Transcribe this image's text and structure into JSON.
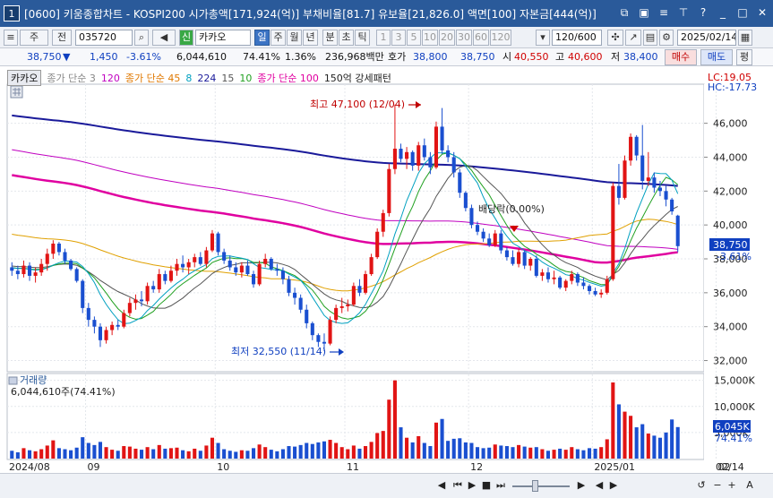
{
  "window": {
    "number": "1",
    "title": "[0600] 키움종합차트 - KOSPI200 시가총액[171,924(억)] 부채비율[81.7] 유보율[21,826.0] 액면[100] 자본금[444(억)]"
  },
  "toolbar": {
    "period_main": "주",
    "period_prev": "전",
    "stock_code": "035720",
    "signal": "신",
    "stock_name": "카카오",
    "periods": [
      "일",
      "주",
      "월",
      "년",
      "분",
      "초",
      "틱"
    ],
    "selected_period": "일",
    "intervals": [
      "1",
      "3",
      "5",
      "10",
      "20",
      "30",
      "60",
      "120"
    ],
    "count": "120/600",
    "date": "2025/02/14"
  },
  "infobar": {
    "price": "38,750",
    "arrow": "▼",
    "change": "1,450",
    "rate": "-3.61%",
    "volume": "6,044,610",
    "vol_rate": "74.41%",
    "turnover": "1.36%",
    "amount": "236,968백만",
    "bid_label": "호가",
    "bid": "38,800",
    "ask": "38,750",
    "open_label": "시",
    "open": "40,550",
    "high_label": "고",
    "high": "40,600",
    "low_label": "저",
    "low": "38,400",
    "buy": "매수",
    "sell": "매도",
    "eval": "평"
  },
  "legend": {
    "stock": "카카오",
    "items": [
      {
        "text": "종가 단순 3",
        "color": "#888888"
      },
      {
        "text": "120",
        "color": "#c000c0"
      },
      {
        "text": "종가 단순 45",
        "color": "#e07800"
      },
      {
        "text": "8",
        "color": "#00a0c0"
      },
      {
        "text": "224",
        "color": "#1a1a9a"
      },
      {
        "text": "15",
        "color": "#555555"
      },
      {
        "text": "10",
        "color": "#20a020"
      },
      {
        "text": "종가 단순 100",
        "color": "#e000a0"
      },
      {
        "text": "150억 강세패턴",
        "color": "#222222"
      }
    ]
  },
  "annotations": {
    "high": "최고 47,100 (12/04)",
    "low": "최저 32,550 (11/14)",
    "event": "배당락(0.00%)",
    "lc": "LC:19.05",
    "hc": "HC:-17.73",
    "cur_price": "38,750",
    "cur_rate": "-3.61%"
  },
  "volume_panel": {
    "title": "거래량",
    "value": "6,044,610주(74.41%)",
    "cur": "6,045K",
    "rate": "74.41%"
  },
  "chart_data": {
    "type": "candlestick",
    "price_axis": {
      "ticks": [
        32000,
        34000,
        36000,
        38000,
        40000,
        42000,
        44000,
        46000
      ],
      "range": [
        31500,
        48200
      ]
    },
    "volume_axis": {
      "ticks": [
        "5,000K",
        "10,000K",
        "15,000K"
      ],
      "max": 15800
    },
    "x_labels": [
      "2024/08",
      "09",
      "10",
      "11",
      "12",
      "2025/01",
      "02",
      "02/14"
    ],
    "ohlcv": [
      [
        37500,
        37800,
        37000,
        37300,
        1500
      ],
      [
        37300,
        37600,
        36800,
        37100,
        1200
      ],
      [
        37100,
        37900,
        36900,
        37600,
        2000
      ],
      [
        37600,
        37800,
        36700,
        37000,
        1600
      ],
      [
        37000,
        37500,
        36600,
        37200,
        1400
      ],
      [
        37200,
        38000,
        37000,
        37700,
        1800
      ],
      [
        37700,
        38600,
        37300,
        38300,
        2500
      ],
      [
        38300,
        39100,
        38000,
        38900,
        3500
      ],
      [
        38900,
        39000,
        38200,
        38400,
        2000
      ],
      [
        38400,
        38600,
        37700,
        37900,
        1800
      ],
      [
        37900,
        38000,
        37300,
        37400,
        1600
      ],
      [
        37400,
        37500,
        36600,
        36700,
        2100
      ],
      [
        36700,
        36800,
        34800,
        35100,
        4100
      ],
      [
        35100,
        35400,
        34000,
        34400,
        3000
      ],
      [
        34400,
        34600,
        33600,
        34000,
        2600
      ],
      [
        34000,
        34200,
        32800,
        33200,
        3200
      ],
      [
        33200,
        34000,
        33000,
        33800,
        2200
      ],
      [
        33800,
        34300,
        33500,
        34100,
        1700
      ],
      [
        34100,
        34400,
        33800,
        34000,
        1500
      ],
      [
        34000,
        35000,
        33900,
        34800,
        2400
      ],
      [
        34800,
        35700,
        34600,
        35400,
        2300
      ],
      [
        35400,
        35900,
        35000,
        35600,
        1900
      ],
      [
        35600,
        36100,
        35200,
        35500,
        1700
      ],
      [
        35500,
        36600,
        35300,
        36400,
        2200
      ],
      [
        36400,
        36700,
        36000,
        36200,
        1800
      ],
      [
        36200,
        37400,
        36000,
        37100,
        2600
      ],
      [
        37100,
        37300,
        36500,
        36700,
        1900
      ],
      [
        36700,
        37600,
        36600,
        37300,
        2000
      ],
      [
        37300,
        38000,
        37000,
        37700,
        2100
      ],
      [
        37700,
        38200,
        37200,
        37500,
        1600
      ],
      [
        37500,
        38000,
        37100,
        37800,
        1400
      ],
      [
        37800,
        38300,
        37500,
        38100,
        1900
      ],
      [
        38100,
        38400,
        37600,
        37700,
        1500
      ],
      [
        37700,
        38700,
        37500,
        38500,
        2500
      ],
      [
        38500,
        39700,
        38400,
        39500,
        4000
      ],
      [
        39500,
        39600,
        38200,
        38400,
        3000
      ],
      [
        38400,
        38600,
        37700,
        37900,
        1800
      ],
      [
        37900,
        38200,
        37300,
        37500,
        1500
      ],
      [
        37500,
        37800,
        37000,
        37200,
        1300
      ],
      [
        37200,
        37800,
        36900,
        37600,
        1600
      ],
      [
        37600,
        37900,
        37000,
        37100,
        1500
      ],
      [
        37100,
        37300,
        36300,
        36500,
        2000
      ],
      [
        36500,
        37900,
        36400,
        37700,
        2700
      ],
      [
        37700,
        38300,
        37500,
        38000,
        2200
      ],
      [
        38000,
        38100,
        37300,
        37400,
        1700
      ],
      [
        37400,
        37700,
        37000,
        37300,
        1400
      ],
      [
        37300,
        37500,
        36500,
        36800,
        1800
      ],
      [
        36800,
        37000,
        35800,
        36000,
        2400
      ],
      [
        36000,
        36300,
        35300,
        35700,
        2300
      ],
      [
        35700,
        35900,
        34800,
        35000,
        2600
      ],
      [
        35000,
        35300,
        33900,
        34200,
        3000
      ],
      [
        34200,
        34300,
        33200,
        33500,
        2800
      ],
      [
        33500,
        33600,
        32800,
        33100,
        3100
      ],
      [
        33100,
        33600,
        32550,
        33000,
        3300
      ],
      [
        33000,
        34600,
        32900,
        34400,
        3600
      ],
      [
        34400,
        35300,
        34200,
        35100,
        3000
      ],
      [
        35100,
        35700,
        34800,
        35200,
        2200
      ],
      [
        35200,
        35600,
        34900,
        35300,
        1800
      ],
      [
        35300,
        36600,
        35200,
        36400,
        2500
      ],
      [
        36400,
        36800,
        35800,
        36000,
        1900
      ],
      [
        36000,
        37300,
        35900,
        37100,
        2400
      ],
      [
        37100,
        38300,
        37000,
        38100,
        3200
      ],
      [
        38100,
        39800,
        38000,
        39600,
        4900
      ],
      [
        39600,
        40900,
        39300,
        40700,
        5300
      ],
      [
        40700,
        43600,
        40500,
        43300,
        11300
      ],
      [
        43300,
        47100,
        43000,
        44500,
        15000
      ],
      [
        44500,
        44800,
        43700,
        43900,
        6000
      ],
      [
        43900,
        44600,
        43300,
        44300,
        4000
      ],
      [
        44300,
        44400,
        43200,
        43500,
        3100
      ],
      [
        43500,
        44900,
        43200,
        44700,
        4300
      ],
      [
        44700,
        45100,
        43800,
        44000,
        3000
      ],
      [
        44000,
        44300,
        43000,
        43400,
        2400
      ],
      [
        43400,
        46100,
        43300,
        45800,
        6900
      ],
      [
        45800,
        46900,
        44200,
        44400,
        7600
      ],
      [
        44400,
        44700,
        43700,
        44000,
        3400
      ],
      [
        44000,
        44300,
        42800,
        43100,
        3800
      ],
      [
        43100,
        43300,
        41600,
        41900,
        3900
      ],
      [
        41900,
        42000,
        40800,
        41000,
        3100
      ],
      [
        41000,
        41200,
        39800,
        40000,
        3000
      ],
      [
        40000,
        40200,
        39400,
        39600,
        2200
      ],
      [
        39600,
        39800,
        39000,
        39200,
        2000
      ],
      [
        39200,
        39500,
        38700,
        38800,
        2100
      ],
      [
        38800,
        39700,
        38700,
        39500,
        2700
      ],
      [
        39500,
        39700,
        38300,
        38500,
        2500
      ],
      [
        38500,
        38700,
        37900,
        38100,
        2400
      ],
      [
        38100,
        38500,
        37600,
        37700,
        2200
      ],
      [
        37700,
        38600,
        37500,
        38400,
        2600
      ],
      [
        38400,
        38500,
        37400,
        37600,
        2300
      ],
      [
        37600,
        38100,
        37300,
        38000,
        2100
      ],
      [
        38000,
        38200,
        36900,
        37000,
        2200
      ],
      [
        37000,
        37400,
        36700,
        37200,
        1800
      ],
      [
        37200,
        37500,
        36600,
        36800,
        1500
      ],
      [
        36800,
        37300,
        36500,
        36900,
        1700
      ],
      [
        36900,
        37000,
        36200,
        36300,
        1900
      ],
      [
        36300,
        36800,
        36100,
        36700,
        1700
      ],
      [
        36700,
        37300,
        36500,
        37100,
        2200
      ],
      [
        37100,
        37200,
        36400,
        36600,
        1800
      ],
      [
        36600,
        36900,
        36200,
        36400,
        1600
      ],
      [
        36400,
        36500,
        35900,
        36100,
        2000
      ],
      [
        36100,
        36300,
        35800,
        35900,
        1900
      ],
      [
        35900,
        36200,
        35700,
        36000,
        2200
      ],
      [
        36000,
        37000,
        35900,
        36800,
        3700
      ],
      [
        36800,
        42500,
        36700,
        42300,
        14600
      ],
      [
        42300,
        43600,
        41200,
        41600,
        10400
      ],
      [
        41600,
        44100,
        41500,
        43800,
        9000
      ],
      [
        43800,
        45400,
        43500,
        45200,
        8200
      ],
      [
        45200,
        45300,
        43800,
        44100,
        6000
      ],
      [
        44100,
        45900,
        42100,
        42600,
        6600
      ],
      [
        42600,
        44300,
        42300,
        42800,
        4800
      ],
      [
        42800,
        43100,
        41900,
        42200,
        4400
      ],
      [
        42200,
        42600,
        41700,
        42000,
        4000
      ],
      [
        42000,
        42300,
        41100,
        41500,
        5000
      ],
      [
        41500,
        41600,
        40600,
        40800,
        7500
      ],
      [
        40550,
        40600,
        38400,
        38750,
        6045
      ]
    ]
  }
}
